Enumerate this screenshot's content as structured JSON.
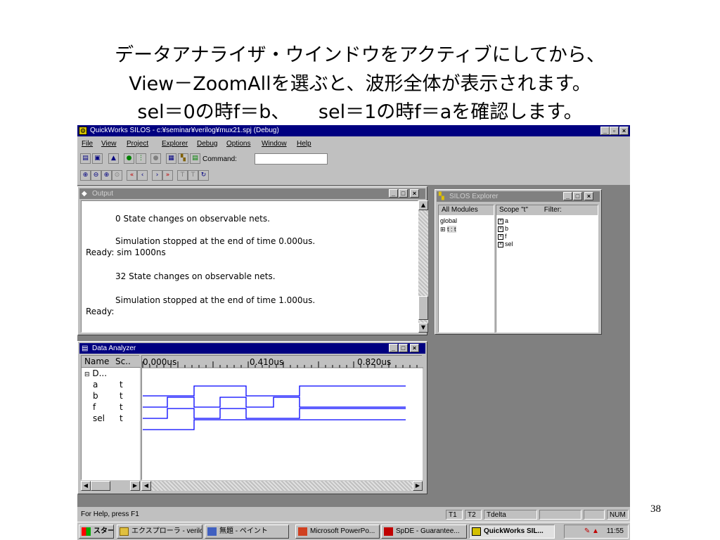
{
  "slide": {
    "line1": "データアナライザ・ウインドウをアクティブにしてから、",
    "line2": "View－ZoomAllを選ぶと、波形全体が表示されます。",
    "line3": "sel＝0の時f＝b、　　sel＝1の時f＝aを確認します。",
    "page_number": "38"
  },
  "app": {
    "title": "QuickWorks SILOS - c:¥seminar¥verilog¥mux21.spj (Debug)",
    "menu": [
      "File",
      "View",
      "Project",
      "Explorer",
      "Debug",
      "Options",
      "Window",
      "Help"
    ],
    "command_label": "Command:",
    "command_value": ""
  },
  "output_window": {
    "title": "Output",
    "lines": [
      "0 State changes on observable nets.",
      "Simulation stopped at the end of time 0.000us.",
      "Ready: sim 1000ns",
      "32 State changes on observable nets.",
      "Simulation stopped at the end of time 1.000us.",
      "Ready:"
    ]
  },
  "explorer": {
    "title": "SILOS Explorer",
    "left_header": "All Modules",
    "tree": [
      "global",
      "t : t"
    ],
    "right_header": "Scope \"t\"",
    "filter_label": "Filter:",
    "signals": [
      "a",
      "b",
      "f",
      "sel"
    ]
  },
  "analyzer": {
    "title": "Data Analyzer",
    "col_name": "Name",
    "col_scope": "Sc..",
    "group": "D...",
    "rows": [
      {
        "name": "a",
        "scope": "t"
      },
      {
        "name": "b",
        "scope": "t"
      },
      {
        "name": "f",
        "scope": "t"
      },
      {
        "name": "sel",
        "scope": "t"
      }
    ],
    "time_labels": [
      "0.000us",
      "0.410us",
      "0.820us"
    ],
    "wave_color": "#0000ff"
  },
  "status": {
    "help": "For Help, press F1",
    "t1": "T1",
    "t2": "T2",
    "tdelta": "Tdelta",
    "num": "NUM"
  },
  "taskbar": {
    "start": "スタート",
    "tasks": [
      "エクスプローラ - verilog",
      "無題 - ペイント",
      "Microsoft PowerPo...",
      "SpDE - Guarantee...",
      "QuickWorks SIL..."
    ],
    "clock": "11:55"
  }
}
